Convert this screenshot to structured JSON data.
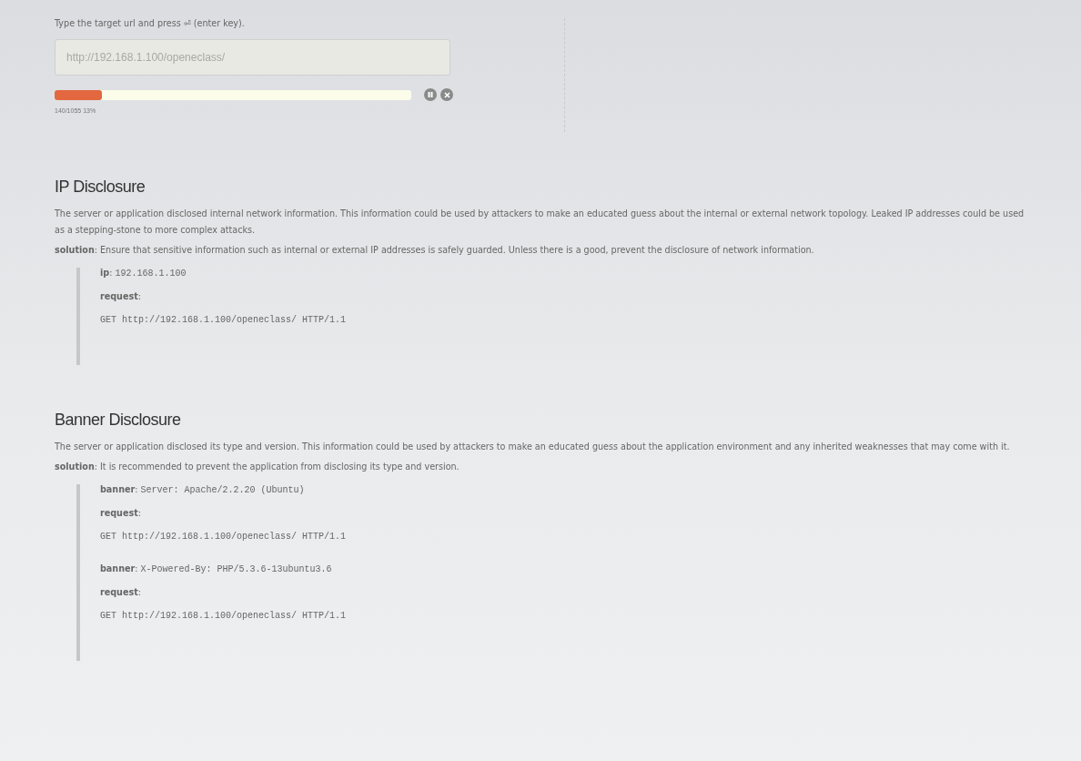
{
  "instruction": "Type the target url and press ⏎ (enter key).",
  "url_field": {
    "placeholder": "http://192.168.1.100/openeclass/"
  },
  "progress": {
    "level": 0.133,
    "reading": "140/1055 13%"
  },
  "findings": [
    {
      "title": "IP Disclosure",
      "description": "The server or application disclosed internal network information. This information could be used by attackers to make an educated guess about the internal or external network topology. Leaked IP addresses could be used as a stepping-stone to more complex attacks.",
      "solution": "**solution**: Ensure that sensitive information such as internal or external IP addresses is safely guarded. Unless there is a good, prevent the disclosure of network information.",
      "evidence": [
        {
          "label": "**ip**:",
          "value": "192.168.1.100",
          "request_label": "**request**:",
          "request": "GET http://192.168.1.100/openeclass/ HTTP/1.1"
        }
      ]
    },
    {
      "title": "Banner Disclosure",
      "description": "The server or application disclosed its type and version. This information could be used by attackers to make an educated guess about the application environment and any inherited weaknesses that may come with it.",
      "solution": "**solution**: It is recommended to prevent the application from disclosing its type and version.",
      "evidence": [
        {
          "label": "**banner**:",
          "value": "Server: Apache/2.2.20 (Ubuntu)",
          "request_label": "**request**:",
          "request": "GET http://192.168.1.100/openeclass/ HTTP/1.1"
        },
        {
          "label": "**banner**:",
          "value": "X-Powered-By: PHP/5.3.6-13ubuntu3.6",
          "request_label": "**request**:",
          "request": "GET http://192.168.1.100/openeclass/ HTTP/1.1"
        }
      ]
    }
  ]
}
